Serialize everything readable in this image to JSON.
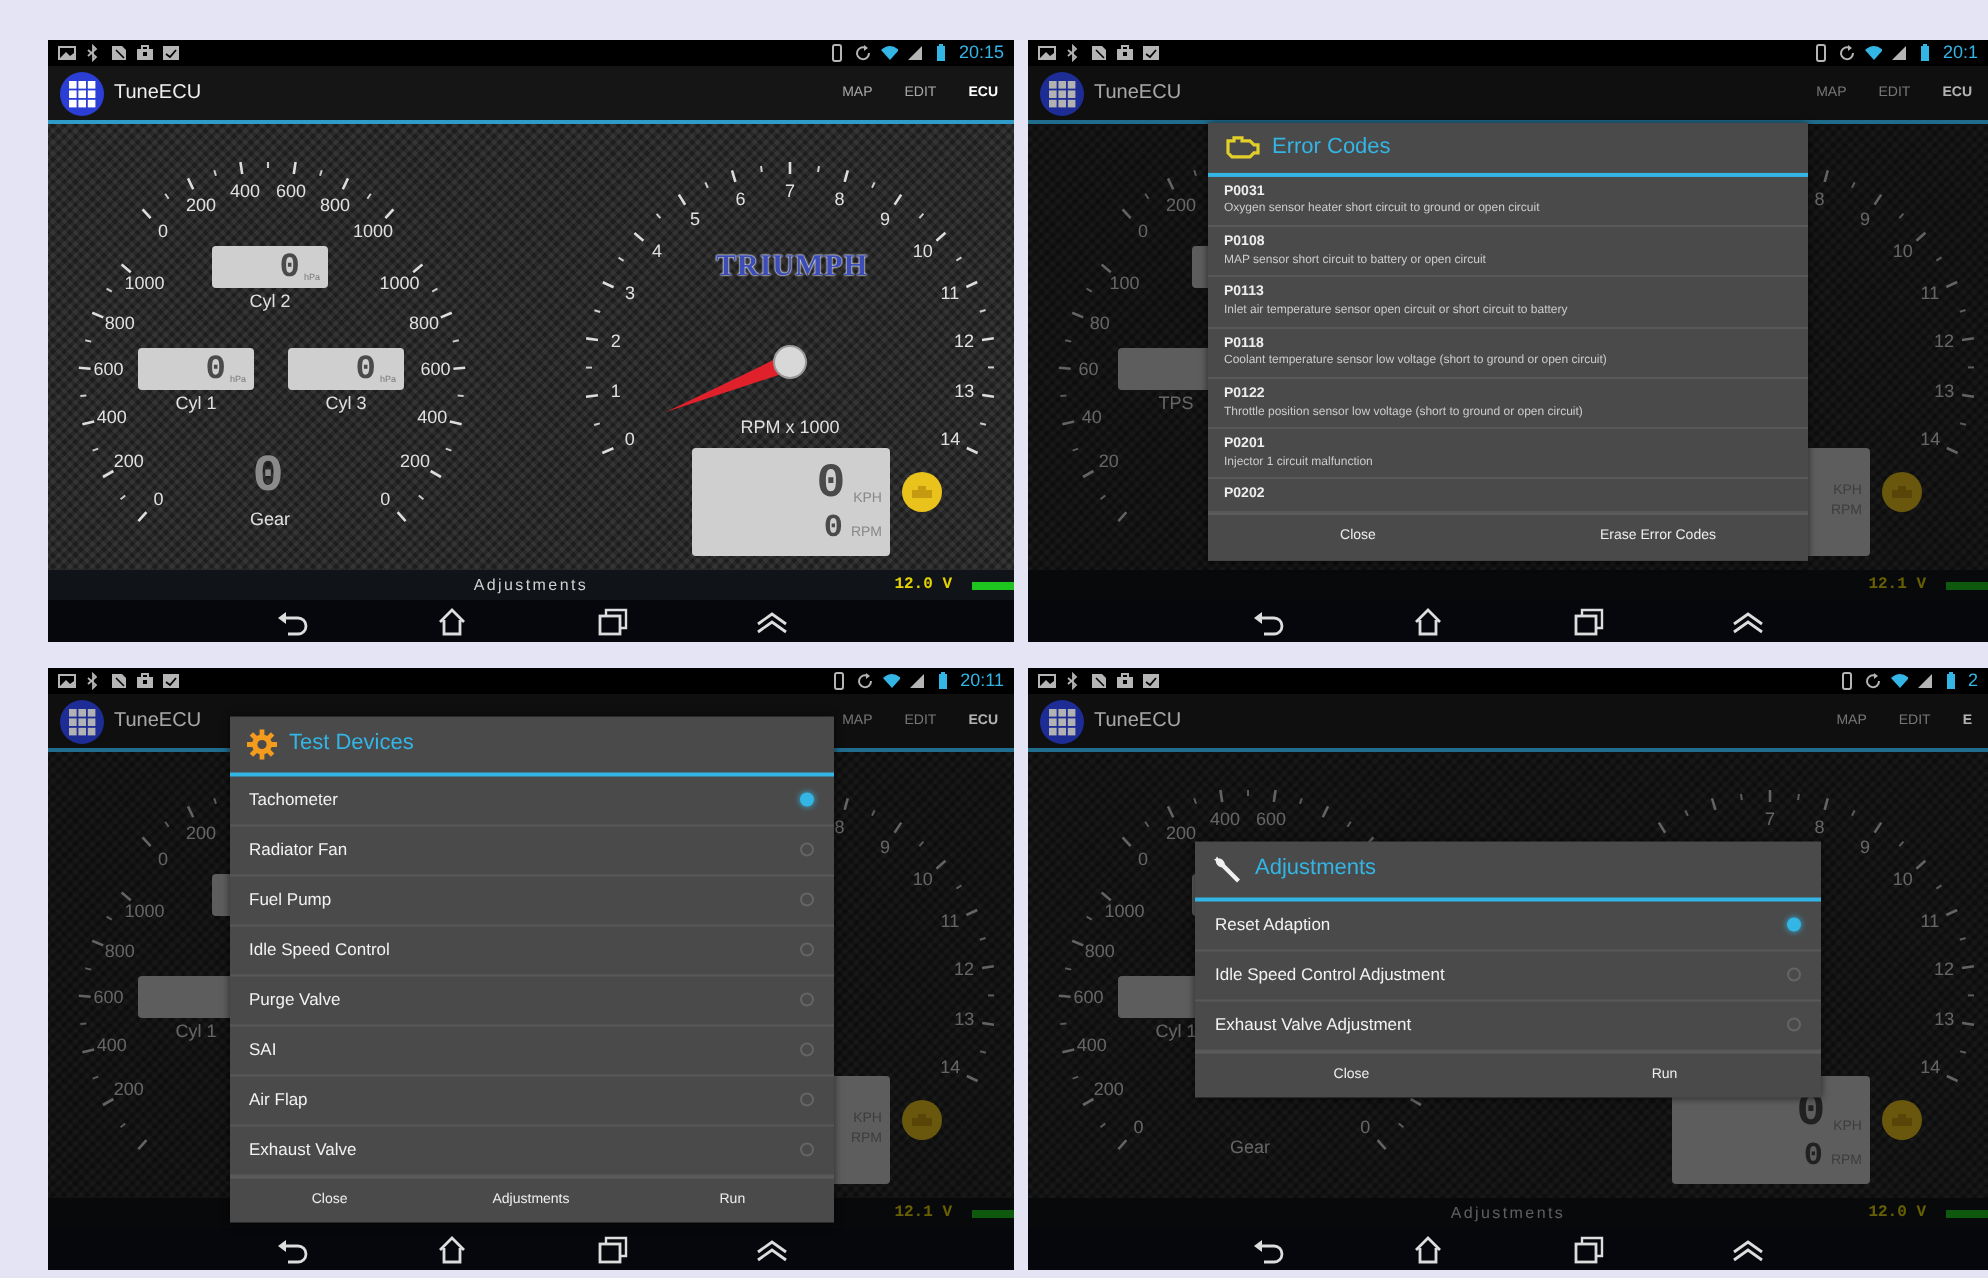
{
  "screens": [
    {
      "status_bar": {
        "time": "20:15"
      },
      "action_bar": {
        "title": "TuneECU",
        "tabs": [
          {
            "label": "MAP",
            "selected": false
          },
          {
            "label": "EDIT",
            "selected": false
          },
          {
            "label": "ECU",
            "selected": true
          }
        ]
      },
      "dashboard": {
        "top_gauge": [
          "0",
          "200",
          "400",
          "600",
          "800",
          "1000"
        ],
        "left_gauge": [
          "1000",
          "800",
          "600",
          "400",
          "200",
          "0"
        ],
        "right_gauge": [
          "1000",
          "800",
          "600",
          "400",
          "200",
          "0"
        ],
        "cylinder_displays": {
          "top": {
            "value": "0",
            "unit": "hPa",
            "label": "Cyl 2"
          },
          "left": {
            "value": "0",
            "unit": "hPa",
            "label": "Cyl 1"
          },
          "right": {
            "value": "0",
            "unit": "hPa",
            "label": "Cyl 3"
          }
        },
        "gear": {
          "value": "0",
          "label": "Gear"
        },
        "tachometer": {
          "labels": [
            "0",
            "1",
            "2",
            "3",
            "4",
            "5",
            "6",
            "7",
            "8",
            "9",
            "10",
            "11",
            "12",
            "13",
            "14"
          ],
          "logo": "TRIUMPH",
          "caption": "RPM x 1000"
        },
        "speed_display": {
          "speed": "0",
          "speed_unit": "KPH",
          "rpm": "0",
          "rpm_unit": "RPM"
        },
        "bottom_label": "Adjustments",
        "voltage": "12.0 V"
      }
    },
    {
      "status_bar": {
        "time": "20:1"
      },
      "action_bar": {
        "title": "TuneECU",
        "tabs": [
          {
            "label": "MAP",
            "selected": false
          },
          {
            "label": "EDIT",
            "selected": false
          },
          {
            "label": "ECU",
            "selected": true
          }
        ]
      },
      "dashboard": {
        "top_gauge": [
          "0",
          "200"
        ],
        "left_gauge": [
          "100",
          "80",
          "60",
          "40",
          "20"
        ],
        "cylinder_displays": {
          "left": {
            "label": "TPS"
          }
        },
        "tachometer": {
          "labels": [
            "8",
            "9",
            "10",
            "11",
            "12",
            "13",
            "14"
          ]
        },
        "speed_display": {
          "speed_unit": "KPH",
          "rpm_unit": "RPM"
        },
        "voltage": "12.1 V"
      },
      "dialog": {
        "kind": "codes",
        "title": "Error Codes",
        "items": [
          {
            "code": "P0031",
            "description": "Oxygen sensor heater short circuit to ground or open circuit"
          },
          {
            "code": "P0108",
            "description": "MAP sensor short circuit to battery or open circuit"
          },
          {
            "code": "P0113",
            "description": "Inlet air temperature sensor open circuit or short circuit to battery"
          },
          {
            "code": "P0118",
            "description": "Coolant temperature sensor low voltage (short to ground or open circuit)"
          },
          {
            "code": "P0122",
            "description": "Throttle position sensor low voltage (short to ground or open circuit)"
          },
          {
            "code": "P0201",
            "description": "Injector 1 circuit malfunction"
          },
          {
            "code": "P0202"
          }
        ],
        "buttons": [
          "Close",
          "Erase Error Codes"
        ]
      }
    },
    {
      "status_bar": {
        "time": "20:11"
      },
      "action_bar": {
        "title": "TuneECU",
        "tabs": [
          {
            "label": "MAP",
            "selected": false
          },
          {
            "label": "EDIT",
            "selected": false
          },
          {
            "label": "ECU",
            "selected": true
          }
        ]
      },
      "dashboard": {
        "top_gauge": [
          "0",
          "200"
        ],
        "left_gauge": [
          "1000",
          "800",
          "600",
          "400",
          "200"
        ],
        "cylinder_displays": {
          "left": {
            "label": "Cyl 1"
          }
        },
        "tachometer": {
          "labels": [
            "8",
            "9",
            "10",
            "11",
            "12",
            "13",
            "14"
          ]
        },
        "speed_display": {
          "speed_unit": "KPH",
          "rpm_unit": "RPM"
        },
        "voltage": "12.1 V"
      },
      "dialog": {
        "kind": "devices",
        "title": "Test Devices",
        "items": [
          {
            "label": "Tachometer",
            "selected": true
          },
          {
            "label": "Radiator Fan",
            "selected": false
          },
          {
            "label": "Fuel Pump",
            "selected": false
          },
          {
            "label": "Idle Speed Control",
            "selected": false
          },
          {
            "label": "Purge Valve",
            "selected": false
          },
          {
            "label": "SAI",
            "selected": false
          },
          {
            "label": "Air Flap",
            "selected": false
          },
          {
            "label": "Exhaust Valve",
            "selected": false
          }
        ],
        "buttons": [
          "Close",
          "Adjustments",
          "Run"
        ]
      }
    },
    {
      "status_bar": {
        "time": "2"
      },
      "action_bar": {
        "title": "TuneECU",
        "tabs": [
          {
            "label": "MAP",
            "selected": false
          },
          {
            "label": "EDIT",
            "selected": false
          },
          {
            "label": "E",
            "selected": true
          }
        ]
      },
      "dashboard": {
        "top_gauge": [
          "0",
          "200",
          "400",
          "600"
        ],
        "left_gauge": [
          "1000",
          "800",
          "600",
          "400",
          "200",
          "0"
        ],
        "right_gauge": [
          "0"
        ],
        "cylinder_displays": {
          "left": {
            "label": "Cyl 1"
          }
        },
        "gear": {
          "label": "Gear"
        },
        "tachometer": {
          "labels": [
            "7",
            "8",
            "9",
            "10",
            "11",
            "12",
            "13",
            "14"
          ]
        },
        "speed_display": {
          "speed": "0",
          "speed_unit": "KPH",
          "rpm": "0",
          "rpm_unit": "RPM"
        },
        "bottom_label": "Adjustments",
        "voltage": "12.0 V"
      },
      "dialog": {
        "kind": "adjustments",
        "title": "Adjustments",
        "items": [
          {
            "label": "Reset Adaption",
            "selected": true
          },
          {
            "label": "Idle Speed Control Adjustment",
            "selected": false
          },
          {
            "label": "Exhaust Valve Adjustment",
            "selected": false
          }
        ],
        "buttons": [
          "Close",
          "Run"
        ]
      }
    }
  ]
}
